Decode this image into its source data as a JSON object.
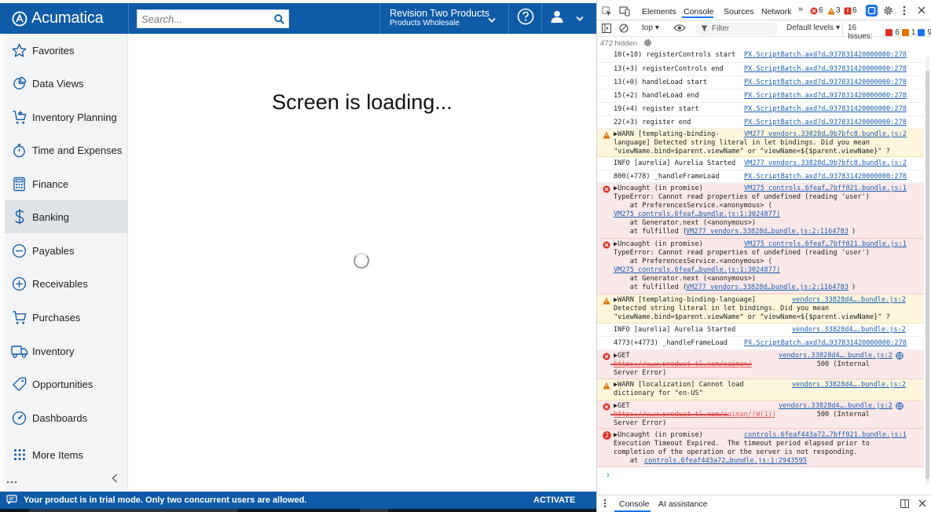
{
  "app": {
    "logo_text": "Acumatica",
    "search_placeholder": "Search...",
    "company_name": "Revision Two Products",
    "company_branch": "Products Wholesale"
  },
  "sidebar": {
    "items": [
      {
        "label": "Favorites",
        "icon": "star-icon"
      },
      {
        "label": "Data Views",
        "icon": "pie-chart-icon"
      },
      {
        "label": "Inventory Planning",
        "icon": "cart-plus-icon"
      },
      {
        "label": "Time and Expenses",
        "icon": "stopwatch-icon"
      },
      {
        "label": "Finance",
        "icon": "calculator-icon"
      },
      {
        "label": "Banking",
        "icon": "dollar-icon"
      },
      {
        "label": "Payables",
        "icon": "minus-circle-icon"
      },
      {
        "label": "Receivables",
        "icon": "plus-circle-icon"
      },
      {
        "label": "Purchases",
        "icon": "cart-icon"
      },
      {
        "label": "Inventory",
        "icon": "truck-icon"
      },
      {
        "label": "Opportunities",
        "icon": "tag-icon"
      },
      {
        "label": "Dashboards",
        "icon": "dashboard-icon"
      },
      {
        "label": "More Items",
        "icon": "grid-dots-icon"
      }
    ],
    "active": "Banking"
  },
  "main": {
    "loading_text": "Screen is loading..."
  },
  "trial_bar": {
    "message": "Your product is in trial mode. Only two concurrent users are allowed.",
    "action": "ACTIVATE"
  },
  "devtools": {
    "tabs": [
      "Elements",
      "Console",
      "Sources",
      "Network"
    ],
    "active_tab": "Console",
    "error_count": "6",
    "warning_count": "3",
    "issue_count": "6",
    "context": "top",
    "filter_placeholder": "Filter",
    "levels": "Default levels",
    "issues_label": "16 Issues:",
    "issues_err": "6",
    "issues_warn": "1",
    "issues_info": "9",
    "hidden": "472 hidden",
    "drawer_tabs": [
      "Console",
      "AI assistance"
    ]
  },
  "console_lines": [
    {
      "type": "log",
      "text": "10(+10) registerControls start",
      "link": "PX.ScriptBatch.axd?d…937831420000000:278"
    },
    {
      "type": "log",
      "text": "13(+3) registerControls end",
      "link": "PX.ScriptBatch.axd?d…937831420000000:278"
    },
    {
      "type": "log",
      "text": "13(+0) handleLoad start",
      "link": "PX.ScriptBatch.axd?d…937831420000000:278"
    },
    {
      "type": "log",
      "text": "15(+2) handleLoad end",
      "link": "PX.ScriptBatch.axd?d…937831420000000:278"
    },
    {
      "type": "log",
      "text": "19(+4) register start",
      "link": "PX.ScriptBatch.axd?d…937831420000000:278"
    },
    {
      "type": "log",
      "text": "22(+3) register end",
      "link": "PX.ScriptBatch.axd?d…937831420000000:278"
    },
    {
      "type": "warn",
      "text": "▶WARN [templating-binding-\nlanguage] Detected string literal in let bindings. Did you mean\n\"viewName.bind=$parent.viewName\" or \"viewName=${$parent.viewName}\" ?",
      "link": "VM277 vendors.33828d…9b7bfc8.bundle.js:2"
    },
    {
      "type": "log",
      "text": "INFO [aurelia] Aurelia Started",
      "link": "VM277 vendors.33828d…9b7bfc8.bundle.js:2"
    },
    {
      "type": "log",
      "text": "800(+778) _handleFrameLoad",
      "link": "PX.ScriptBatch.axd?d…937831420000000:278"
    },
    {
      "type": "err",
      "text": "▶Uncaught (in promise)\nTypeError: Cannot read properties of undefined (reading 'user')\n    at PreferencesService.<anonymous> (\n\n    at Generator.next (<anonymous>)\n    at fulfilled (",
      "link": "VM275 controls.6feaf…7bff021.bundle.js:1",
      "sub1": "VM275 controls.6feaf…bundle.js:1:3024877)",
      "sub2": "VM277 vendors.33828d…bundle.js:2:1164783",
      "sub2_suffix": ")"
    },
    {
      "type": "err",
      "text": "▶Uncaught (in promise)\nTypeError: Cannot read properties of undefined (reading 'user')\n    at PreferencesService.<anonymous> (\n\n    at Generator.next (<anonymous>)\n    at fulfilled (",
      "link": "VM275 controls.6feaf…7bff021.bundle.js:1",
      "sub1": "VM275 controls.6feaf…bundle.js:1:3024877)",
      "sub2": "VM277 vendors.33828d…bundle.js:2:1164783",
      "sub2_suffix": ")"
    },
    {
      "type": "warn",
      "text": "▶WARN [templating-binding-language]\nDetected string literal in let bindings. Did you mean\n\"viewName.bind=$parent.viewName\" or \"viewName=${$parent.viewName}\" ?",
      "link": "vendors.33828d4….bundle.js:2"
    },
    {
      "type": "log",
      "text": "INFO [aurelia] Aurelia Started",
      "link": "vendors.33828d4….bundle.js:2"
    },
    {
      "type": "log",
      "text": "4773(+4773) _handleFrameLoad",
      "link": "PX.ScriptBatch.axd?d…937831420000000:278"
    },
    {
      "type": "err",
      "text": "▶GET\n                                                  500 (Internal\nServer Error)",
      "link": "vendors.33828d4….bundle.js:2",
      "url": "https://w…w.product-tl.com/saiman/(W(1))/ui/locale/en-US"
    },
    {
      "type": "warn",
      "text": "▶WARN [localization] Cannot load\ndictionary for \"en-US\"",
      "link": "vendors.33828d4….bundle.js:2"
    },
    {
      "type": "err",
      "text": "▶GET\n                                                  500 (Internal\nServer Error)",
      "link": "vendors.33828d4….bundle.js:2",
      "url": "https://w…w.product-tl.com/saiman/(W(1))/ui/features/"
    },
    {
      "type": "err",
      "text": "▶Uncaught (in promise)\nExecution Timeout Expired.  The timeout period elapsed prior to\ncompletion of the operation or the server is not responding.\n    at ",
      "link": "controls.6feaf443a72…7bff021.bundle.js:1",
      "sub3": "controls.6feaf443a72…bundle.js:1:2943595",
      "badge": "2"
    }
  ]
}
